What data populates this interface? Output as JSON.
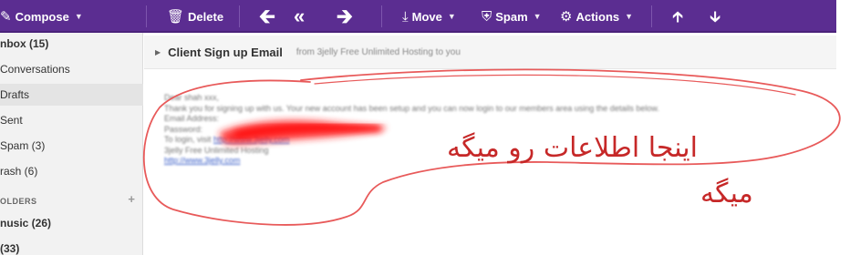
{
  "toolbar": {
    "compose": "Compose",
    "delete": "Delete",
    "move": "Move",
    "spam": "Spam",
    "actions": "Actions"
  },
  "sidebar": {
    "items": [
      {
        "label": "nbox (15)"
      },
      {
        "label": "Conversations"
      },
      {
        "label": "Drafts"
      },
      {
        "label": "Sent"
      },
      {
        "label": "Spam (3)"
      },
      {
        "label": "rash (6)"
      }
    ],
    "folders_header": "OLDERS",
    "folders": [
      {
        "label": "nusic (26)"
      },
      {
        "label": "(33)"
      }
    ]
  },
  "message": {
    "subject": "Client Sign up Email",
    "from_line": "from 3jelly Free Unlimited Hosting to you",
    "body_lines": [
      "Dear shah xxx,",
      "Thank you for signing up with us. Your new account has been setup and you can now login to our members area using the details below.",
      "Email Address:",
      "Password:",
      "To login, visit"
    ],
    "login_link": "http://www.3jelly.com",
    "signature": "3jelly Free Unlimited Hosting",
    "sig_link": "http://www.3jelly.com"
  },
  "annotation": {
    "text_line1": "اینجا اطلاعات رو میگه",
    "text_line2": "میگه",
    "color": "#c62828"
  },
  "colors": {
    "toolbar_bg": "#5b2d91",
    "sidebar_bg": "#f2f2f2"
  }
}
